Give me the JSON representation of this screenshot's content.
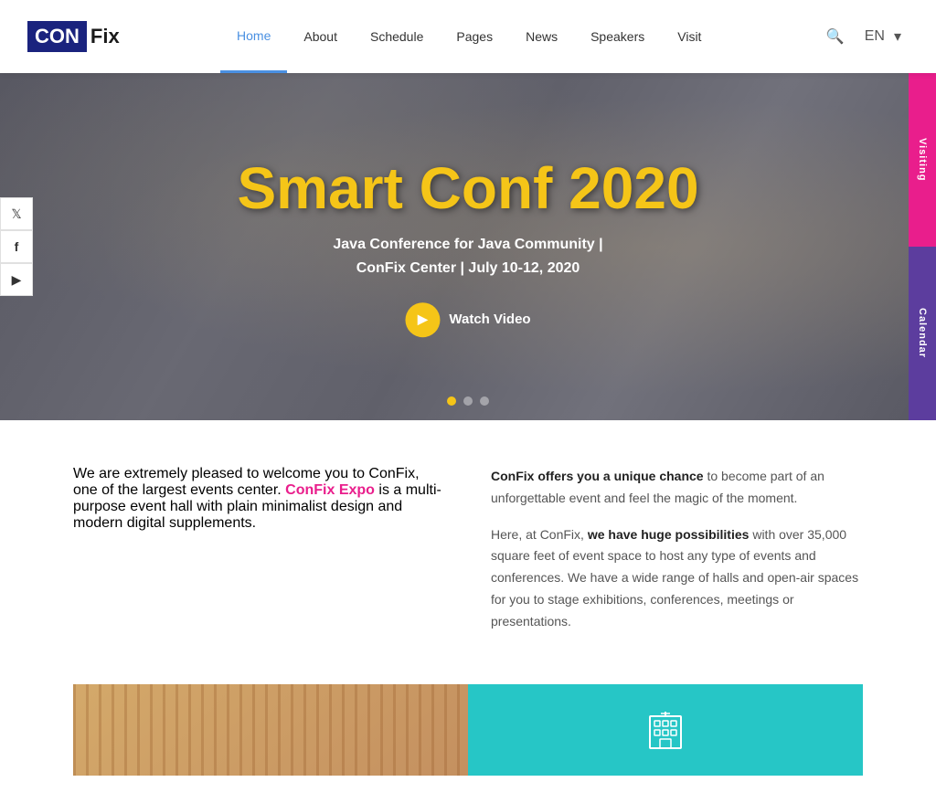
{
  "logo": {
    "con": "CON",
    "fix": "Fix"
  },
  "nav": {
    "items": [
      {
        "label": "Home",
        "active": true
      },
      {
        "label": "About",
        "active": false
      },
      {
        "label": "Schedule",
        "active": false
      },
      {
        "label": "Pages",
        "active": false
      },
      {
        "label": "News",
        "active": false
      },
      {
        "label": "Speakers",
        "active": false
      },
      {
        "label": "Visit",
        "active": false
      }
    ],
    "lang": "EN"
  },
  "hero": {
    "title": "Smart Conf 2020",
    "subtitle_line1": "Java Conference for Java Community |",
    "subtitle_line2": "ConFix Center | July 10-12, 2020",
    "watch_video": "Watch Video",
    "dots": 3
  },
  "social": {
    "twitter": "🐦",
    "facebook": "f",
    "youtube": "▶"
  },
  "right_tabs": {
    "visiting": "Visiting",
    "calendar": "Calendar"
  },
  "about_section": {
    "left_text_1": "We are extremely pleased to welcome you to ConFix, one of the largest events center. ",
    "brand_name": "ConFix Expo",
    "left_text_2": " is a multi-purpose event hall with plain minimalist design and modern digital supplements.",
    "right_para1_bold": "ConFix offers you a unique chance",
    "right_para1_rest": " to become part of an unforgettable event and feel the magic of the moment.",
    "right_para2_intro": "Here, at ConFix, ",
    "right_para2_bold": "we have huge possibilities",
    "right_para2_rest": " with over 35,000 square feet of event space to host any type of events and conferences. We have a wide range of halls and open-air spaces for you to stage exhibitions, conferences, meetings or presentations."
  }
}
